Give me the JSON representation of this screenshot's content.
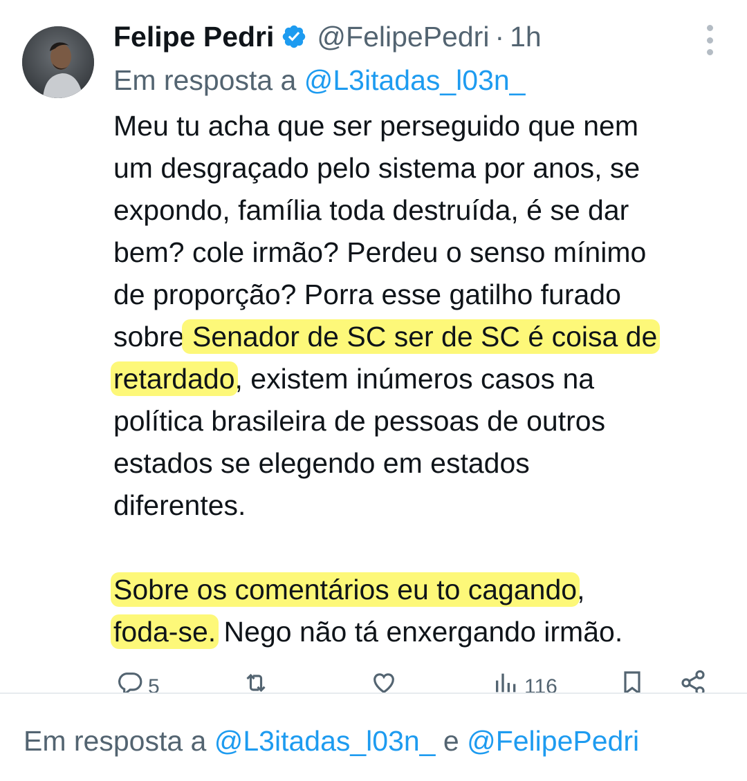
{
  "tweet": {
    "author_name": "Felipe Pedri",
    "handle": "@FelipePedri",
    "separator": "·",
    "time": "1h",
    "reply_prefix": "Em resposta a ",
    "reply_mention": "@L3itadas_l03n_",
    "body_lines": [
      {
        "pre": "Meu tu acha que ser perseguido que nem",
        "hl": "",
        "post": ""
      },
      {
        "pre": "um desgraçado pelo sistema por anos, se",
        "hl": "",
        "post": ""
      },
      {
        "pre": "expondo, família toda destruída, é se dar",
        "hl": "",
        "post": ""
      },
      {
        "pre": "bem? cole irmão? Perdeu o senso mínimo",
        "hl": "",
        "post": ""
      },
      {
        "pre": "de proporção? Porra esse gatilho furado",
        "hl": "",
        "post": ""
      },
      {
        "pre": "sobre",
        "hl": " Senador de SC ser de SC é coisa de",
        "post": ""
      },
      {
        "pre": "",
        "hl": "retardado",
        "post": ", existem inúmeros casos na"
      },
      {
        "pre": "política brasileira de pessoas de outros",
        "hl": "",
        "post": ""
      },
      {
        "pre": "estados se elegendo em estados",
        "hl": "",
        "post": ""
      },
      {
        "pre": "diferentes.",
        "hl": "",
        "post": ""
      },
      {
        "pre": "",
        "hl": "",
        "post": "",
        "blank": true
      },
      {
        "pre": "",
        "hl": "Sobre os comentários eu to cagando",
        "post": ","
      },
      {
        "pre": "",
        "hl": "foda-se.",
        "post": " Nego não tá enxergando irmão."
      }
    ],
    "highlight_color": "#fdf65c",
    "metrics": {
      "replies": "5",
      "views": "116"
    }
  },
  "footer": {
    "prefix": "Em resposta a ",
    "mention1": "@L3itadas_l03n_",
    "joiner": " e ",
    "mention2": "@FelipePedri"
  },
  "colors": {
    "accent": "#1d9bf0",
    "secondary_text": "#536471",
    "primary_text": "#0f1419"
  },
  "icons": [
    "verified-badge-icon",
    "more-options-icon",
    "reply-icon",
    "retweet-icon",
    "like-icon",
    "views-icon",
    "bookmark-icon",
    "share-icon"
  ]
}
